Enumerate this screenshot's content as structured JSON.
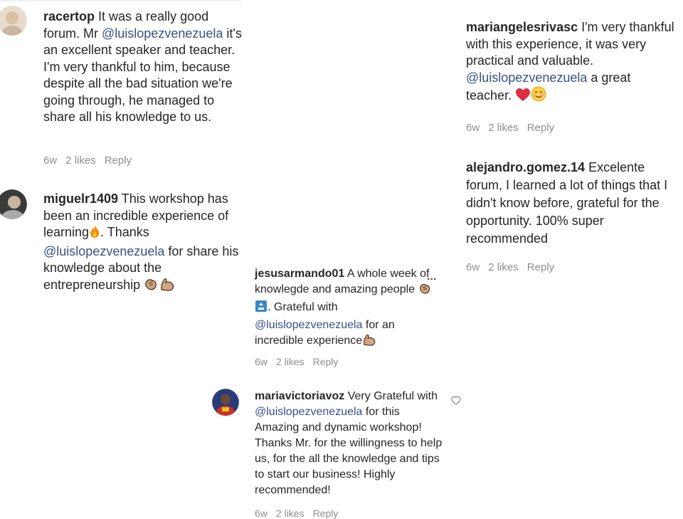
{
  "comments": [
    {
      "username": "racertop",
      "text1": " It was a really good forum. Mr ",
      "mention": "@luislopezvenezuela",
      "text2": " it's an excellent speaker and teacher. I'm very thankful to him, because despite all the bad situation we're going through, he managed to share all his knowledge to us.",
      "time": "6w",
      "likes": "2 likes",
      "reply": "Reply"
    },
    {
      "username": "miguelr1409",
      "text1": " This workshop has been an incredible experience of learning",
      "text2": ". Thanks ",
      "mention": "@luislopezvenezuela",
      "text3": " for share his knowledge about the entrepreneurship "
    },
    {
      "username": "jesusarmando01",
      "text1": " A whole week of knowlegde and amazing people ",
      "text2": ". Grateful with ",
      "mention": "@luislopezvenezuela",
      "text3": " for an incredible experience",
      "more": "...",
      "time": "6w",
      "likes": "2 likes",
      "reply": "Reply"
    },
    {
      "username": "mariavictoriavoz",
      "text1": " Very Grateful with ",
      "mention": "@luislopezvenezuela",
      "text2": " for this Amazing and dynamic workshop! Thanks Mr. for the willingness to help us, for the all the knowledge and tips to start our business! Highly recommended!",
      "time": "6w",
      "likes": "2 likes",
      "reply": "Reply"
    },
    {
      "username": "mariangelesrivasc",
      "text1": " I'm very thankful with this experience, it was very practical and valuable. ",
      "mention": "@luislopezvenezuela",
      "text2": " a great teacher. ",
      "time": "6w",
      "likes": "2 likes",
      "reply": "Reply"
    },
    {
      "username": "alejandro.gomez.14",
      "text1": " Excelente forum, I learned a lot of things that I didn't know before, grateful for the opportunity. 100% super recommended",
      "time": "6w",
      "likes": "2 likes",
      "reply": "Reply"
    }
  ],
  "colors": {
    "mention": "#385185",
    "meta": "#8e8e8e",
    "text": "#262626"
  }
}
